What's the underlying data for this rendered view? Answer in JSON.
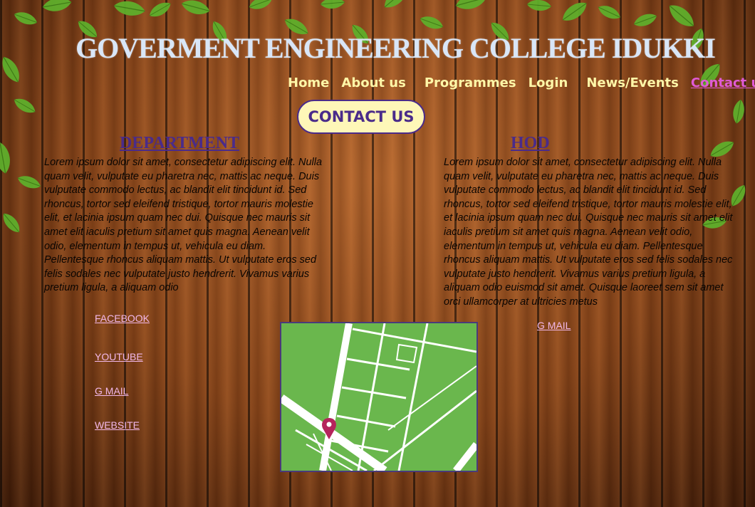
{
  "header": {
    "title": "GOVERMENT ENGINEERING COLLEGE IDUKKI"
  },
  "nav": {
    "items": [
      {
        "label": "Home"
      },
      {
        "label": "About us"
      },
      {
        "label": "Programmes"
      },
      {
        "label": "Login"
      },
      {
        "label": "News/Events"
      },
      {
        "label": "Contact us",
        "active": true
      }
    ]
  },
  "contact_button": {
    "label": "CONTACT US"
  },
  "department": {
    "heading": "DEPARTMENT",
    "text": "Lorem ipsum dolor sit amet, consectetur adipiscing elit. Nulla quam velit, vulputate eu pharetra nec, mattis ac neque. Duis vulputate commodo lectus, ac blandit elit tincidunt id. Sed rhoncus, tortor sed eleifend tristique, tortor mauris molestie elit, et lacinia ipsum quam nec dui. Quisque nec mauris sit amet elit iaculis pretium sit amet quis magna. Aenean velit odio, elementum in tempus ut, vehicula eu diam. Pellentesque rhoncus aliquam mattis. Ut vulputate eros sed felis sodales nec vulputate justo hendrerit. Vivamus varius pretium ligula, a aliquam odio"
  },
  "hod": {
    "heading": "HOD",
    "text": "Lorem ipsum dolor sit amet, consectetur adipiscing elit. Nulla quam velit, vulputate eu pharetra nec, mattis ac neque. Duis vulputate commodo lectus, ac blandit elit tincidunt id. Sed rhoncus, tortor sed eleifend tristique, tortor mauris molestie elit, et lacinia ipsum quam nec dui. Quisque nec mauris sit amet elit iaculis pretium sit amet quis magna. Aenean velit odio, elementum in tempus ut, vehicula eu diam. Pellentesque rhoncus aliquam mattis. Ut vulputate eros sed felis sodales nec vulputate justo hendrerit. Vivamus varius pretium ligula, a aliquam odio euismod sit amet. Quisque laoreet sem sit amet orci ullamcorper at ultricies metus"
  },
  "social_links": {
    "facebook": "FACEBOOK",
    "youtube": "YOUTUBE",
    "gmail": "G MAIL",
    "website": "WEBSITE"
  },
  "hod_links": {
    "gmail": "G MAIL"
  },
  "colors": {
    "nav_text": "#fff7a8",
    "nav_active": "#e05ad6",
    "heading": "#4a2b8a",
    "button_bg": "#fef7b8",
    "map_green": "#6ab74d",
    "map_pin": "#b5245c"
  },
  "icons": {
    "map_pin": "map-pin-icon"
  }
}
